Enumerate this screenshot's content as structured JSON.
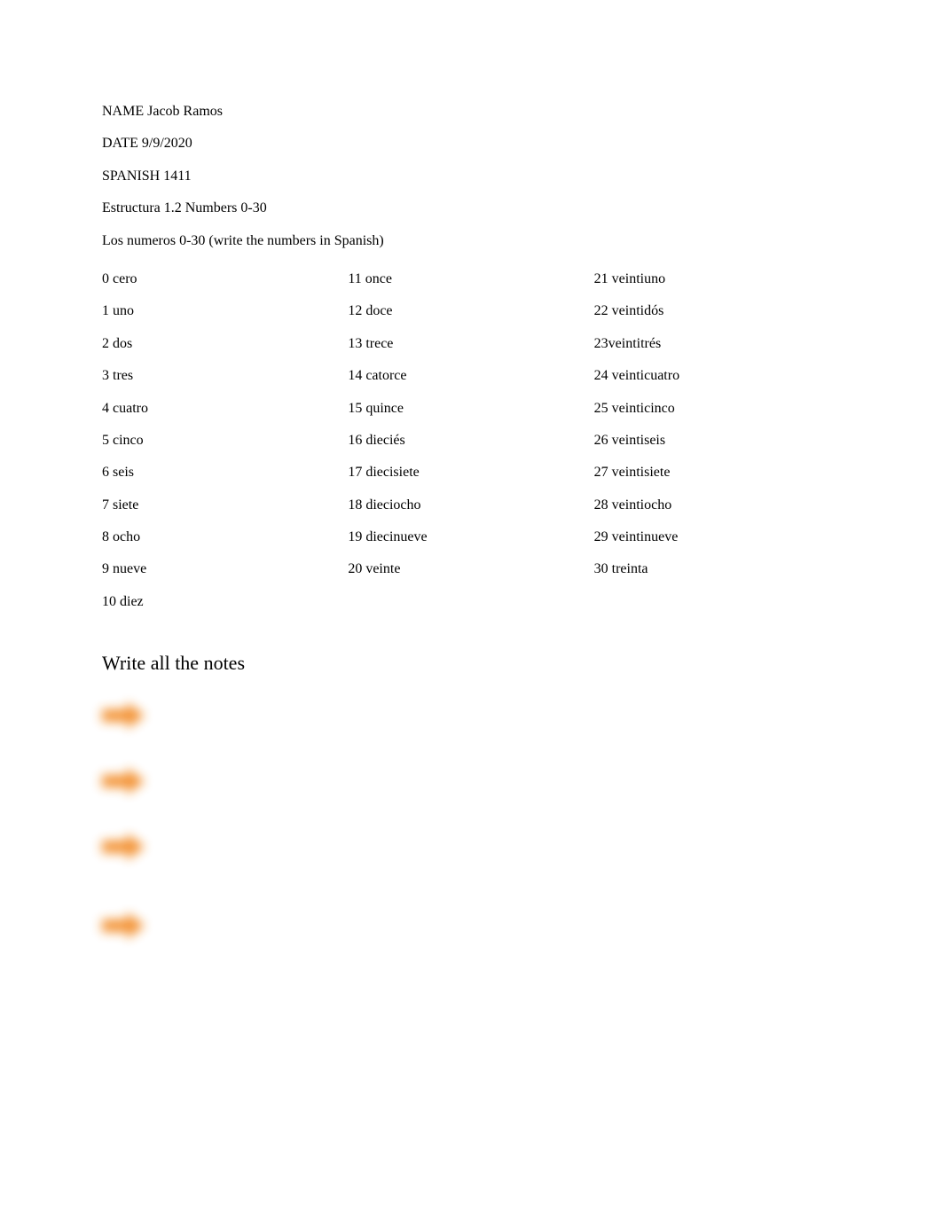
{
  "header": {
    "name_label": "NAME",
    "name_value": "Jacob Ramos",
    "date_label": "DATE",
    "date_value": "9/9/2020",
    "course": "SPANISH 1411",
    "structure_line": " Estructura 1.2 Numbers 0-30",
    "instruction": "Los numeros 0-30 (write the numbers in Spanish)"
  },
  "numbers": {
    "col1": [
      "0 cero",
      "1 uno",
      "2 dos",
      "3 tres",
      "4 cuatro",
      "5 cinco",
      "6 seis",
      "7 siete",
      "8 ocho",
      "9 nueve",
      "10 diez"
    ],
    "col2": [
      "11 once",
      "12 doce",
      "13 trece",
      "14 catorce",
      "15 quince",
      "16 dieciés",
      "17 diecisiete",
      "18 dieciocho",
      "19 diecinueve",
      "20 veinte"
    ],
    "col3": [
      "21 veintiuno",
      "22 veintidós",
      "23veintitrés",
      "24 veinticuatro",
      "25 veinticinco",
      "26 veintiseis",
      "27 veintisiete",
      "28 veintiocho",
      "29 veintinueve",
      "30 treinta"
    ]
  },
  "notes_section": {
    "heading": "Write all the notes",
    "arrow_color": "#f28c28",
    "row_count": 4
  }
}
